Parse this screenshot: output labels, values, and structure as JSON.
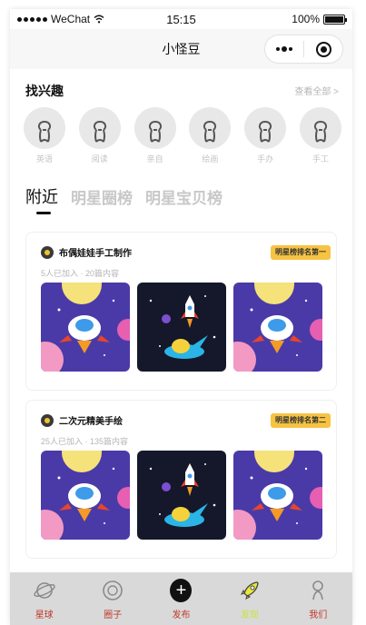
{
  "status_bar": {
    "carrier": "WeChat",
    "time": "15:15",
    "battery": "100%"
  },
  "navbar": {
    "title": "小怪豆"
  },
  "interests": {
    "heading": "找兴趣",
    "view_all": "查看全部 >",
    "items": [
      {
        "label": "英语"
      },
      {
        "label": "阅读"
      },
      {
        "label": "亲自"
      },
      {
        "label": "绘画"
      },
      {
        "label": "手办"
      },
      {
        "label": "手工"
      }
    ]
  },
  "tabs": [
    {
      "label": "附近",
      "active": true
    },
    {
      "label": "明星圈榜",
      "active": false
    },
    {
      "label": "明星宝贝榜",
      "active": false
    }
  ],
  "cards": [
    {
      "name": "布偶娃娃手工制作",
      "badge": "明星榜排名第一",
      "meta": "5人已加入 · 20篇内容",
      "images": [
        "rocket-planets",
        "rocket-space",
        "rocket-planets"
      ]
    },
    {
      "name": "二次元精美手绘",
      "badge": "明星榜排名第二",
      "meta": "25人已加入 · 135篇内容",
      "images": [
        "rocket-planets",
        "rocket-space",
        "rocket-planets"
      ]
    }
  ],
  "tabbar": [
    {
      "label": "星球",
      "icon": "planet-icon"
    },
    {
      "label": "圈子",
      "icon": "circle-icon"
    },
    {
      "label": "发布",
      "icon": "plus-icon"
    },
    {
      "label": "发现",
      "icon": "rocket-icon",
      "active": true
    },
    {
      "label": "我们",
      "icon": "person-icon"
    }
  ],
  "colors": {
    "badge": "#f6c343",
    "tab_label": "#c0392b",
    "tab_active": "#c8e43c",
    "tabbar_bg": "#d9d9d9"
  }
}
